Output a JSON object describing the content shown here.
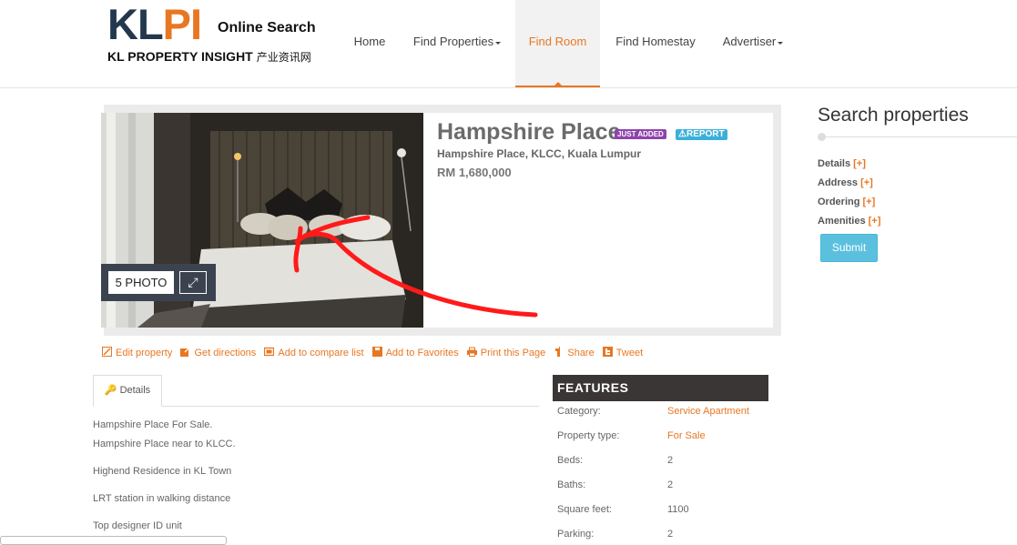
{
  "logo": {
    "kl": "KL",
    "pi": "PI",
    "online": "Online Search",
    "tagline": "KL PROPERTY INSIGHT",
    "tagline_cn": "产业资讯网"
  },
  "nav": [
    {
      "label": "Home",
      "dropdown": false
    },
    {
      "label": "Find Properties",
      "dropdown": true
    },
    {
      "label": "Find Room",
      "dropdown": false,
      "active": true
    },
    {
      "label": "Find Homestay",
      "dropdown": false
    },
    {
      "label": "Advertiser",
      "dropdown": true
    }
  ],
  "listing": {
    "title": "Hampshire Place",
    "tag_new": "JUST ADDED",
    "tag_report": "REPORT",
    "address": "Hampshire Place, KLCC, Kuala Lumpur",
    "price": "RM 1,680,000",
    "photo_count": "5 PHOTO"
  },
  "actions": [
    {
      "label": "Edit property",
      "icon": "edit-icon"
    },
    {
      "label": "Get directions",
      "icon": "directions-icon"
    },
    {
      "label": "Add to compare list",
      "icon": "compare-icon"
    },
    {
      "label": "Add to Favorites",
      "icon": "favorites-icon"
    },
    {
      "label": "Print this Page",
      "icon": "print-icon"
    },
    {
      "label": "Share",
      "icon": "share-icon"
    },
    {
      "label": "Tweet",
      "icon": "tweet-icon"
    }
  ],
  "tabs": {
    "details": "Details"
  },
  "description": [
    "Hampshire Place For Sale.",
    "Hampshire Place near to KLCC.",
    "Highend Residence in KL Town",
    "LRT station in walking distance",
    "Top designer ID unit"
  ],
  "features": {
    "heading": "FEATURES",
    "rows": [
      {
        "label": "Category:",
        "value": "Service Apartment",
        "link": true
      },
      {
        "label": "Property type:",
        "value": "For Sale",
        "link": true
      },
      {
        "label": "Beds:",
        "value": "2",
        "link": false
      },
      {
        "label": "Baths:",
        "value": "2",
        "link": false
      },
      {
        "label": "Square feet:",
        "value": "1100",
        "link": false
      },
      {
        "label": "Parking:",
        "value": "2",
        "link": false
      }
    ]
  },
  "sidebar": {
    "title": "Search properties",
    "filters": [
      {
        "label": "Details",
        "toggle": "[+]"
      },
      {
        "label": "Address",
        "toggle": "[+]"
      },
      {
        "label": "Ordering",
        "toggle": "[+]"
      },
      {
        "label": "Amenities",
        "toggle": "[+]"
      }
    ],
    "submit": "Submit"
  },
  "colors": {
    "accent": "#e87722",
    "navy": "#23374d",
    "info": "#5bc0de",
    "annotation": "#ff1a1a"
  }
}
